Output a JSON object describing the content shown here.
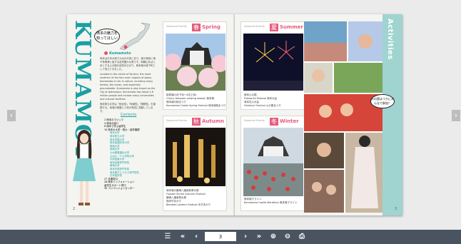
{
  "book": {
    "left_page": {
      "title": "KUMAMOTO",
      "speech": "熊本の魅力を知ってほしい",
      "place_label": "Kumamoto",
      "body_jp": "熊本は日本の南で九州の中央にあり、南や南西に海や有明海と接する自然豊かな県です。阿蘇山をはじめとする火の国の自然が広がり、熊本城の城下町として栄えてきました。",
      "body_en": "Located in the center of Kyushu, the most southern of the four main regions of Japan, Kumamoto is rich in nature, including many forests, the ocean, and especially groundwater. Kumamoto is also known as the city of waterways. Kumamoto has about 1.8 million people and houses many universities and cultural facilities.",
      "body_jp2": "熊本県立大学は「総合性」「地域性」「国際性」を重視する。地域の発展と人材の育成に貢献しています。",
      "contents_title": "Contents",
      "contents": [
        {
          "n": "2",
          "t": "熊本のマジック"
        },
        {
          "n": "4",
          "t": "熊本の紹介"
        },
        {
          "n": "6",
          "t": "熊本で学ぶ留学生"
        },
        {
          "n": "10",
          "t": "熊本の大学・短大・高専機関"
        }
      ],
      "contents_sub": [
        "熊本大学",
        "熊本県立大学",
        "熊本学園大学",
        "熊本保健科学大学",
        "崇城大学",
        "尚絅大学",
        "九州看護福祉大学",
        "九州ルーテル学院大学",
        "平成音楽大学",
        "熊本高等専門学校",
        "東海大学",
        "熊本外語専門学校",
        "熊本電子ビジネス専門学校",
        "日本語学校"
      ],
      "contents_tail": [
        {
          "n": "27",
          "t": "支援窓口"
        },
        {
          "n": "28",
          "t": "熊本インフォメーション"
        },
        {
          "n": "",
          "t": "留学生サポート窓口"
        },
        {
          "n": "30",
          "t": "コンベンションセンター"
        }
      ],
      "page_number": "2"
    },
    "seasons": [
      {
        "header": "Seasonal Events",
        "kanji": "春",
        "en": "Spring",
        "color": "#e65b7d",
        "caption": "桜見頃(3月下旬〜4月上旬)\nCherry blossom viewing season 熊本城\n熊本城の桜まつり\nKumamoto Castle Spring Festival 熊本城桜まつり"
      },
      {
        "header": "Seasonal Events",
        "kanji": "夏",
        "en": "Summer",
        "color": "#e65b7d",
        "caption": "熊本火の国\nFireworks Festival 熊本大会\n熊本花火大会\nHinokuni Festival 火の国まつり"
      },
      {
        "header": "Seasonal Events",
        "kanji": "秋",
        "en": "Autumn",
        "color": "#e65b7d",
        "caption": "熊本城の藤崎八旛宮秋季大祭\nFujisaki Shrine Autumn Festival\n藤崎八旛宮例大祭\n熊本竹あかり\nBamboo Lantern Festival みずあかり"
      },
      {
        "header": "Seasonal Events",
        "kanji": "冬",
        "en": "Winter",
        "color": "#e65b7d",
        "caption": "熊本城マラソン\nKumamoto Castle Marathon 熊本城マラソン"
      }
    ],
    "right_page": {
      "activities": "Activities",
      "bubble": "火の国まつりにみんなで参加！",
      "page_number": "3"
    }
  },
  "viewer": {
    "prev_label": "‹",
    "next_label": "›",
    "current_page": "3",
    "toolbar": {
      "menu": "☰",
      "first": "«",
      "prev": "‹",
      "next": "›",
      "last": "»",
      "zoom_in": "⊕",
      "zoom_out": "⊖",
      "print": "⎙"
    }
  },
  "colors": {
    "teal": "#1a9fa3",
    "toolbar": "#4a5460",
    "pink": "#e65b7d"
  }
}
